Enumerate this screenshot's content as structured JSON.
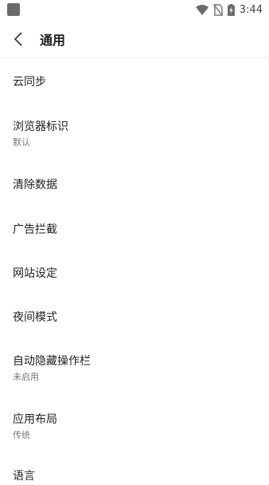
{
  "status_bar": {
    "time": "3:44",
    "icons": [
      "notification-square-icon",
      "wifi-icon",
      "no-sim-icon",
      "battery-charging-icon"
    ]
  },
  "app_bar": {
    "back_icon": "chevron-left-icon",
    "title": "通用"
  },
  "settings": [
    {
      "label": "云同步",
      "sub": ""
    },
    {
      "label": "浏览器标识",
      "sub": "默认"
    },
    {
      "label": "清除数据",
      "sub": ""
    },
    {
      "label": "广告拦截",
      "sub": ""
    },
    {
      "label": "网站设定",
      "sub": ""
    },
    {
      "label": "夜间模式",
      "sub": ""
    },
    {
      "label": "自动隐藏操作栏",
      "sub": "未启用"
    },
    {
      "label": "应用布局",
      "sub": "传统"
    },
    {
      "label": "语言",
      "sub": ""
    }
  ]
}
